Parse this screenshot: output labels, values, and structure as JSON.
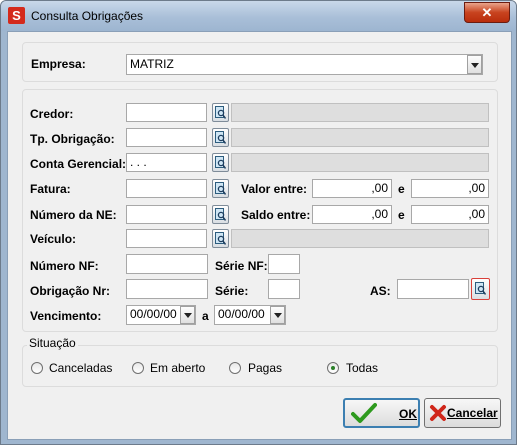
{
  "window": {
    "title": "Consulta Obrigações",
    "app_icon": "S",
    "close_glyph": "✕"
  },
  "empresa": {
    "label": "Empresa:",
    "value": "MATRIZ"
  },
  "filters": {
    "credor": {
      "label": "Credor:",
      "value": ""
    },
    "tp_obrigacao": {
      "label": "Tp. Obrigação:",
      "value": ""
    },
    "conta_gerencial": {
      "label": "Conta Gerencial:",
      "value": " .  .  . "
    },
    "fatura": {
      "label": "Fatura:",
      "value": ""
    },
    "numero_ne": {
      "label": "Número da NE:",
      "value": ""
    },
    "veiculo": {
      "label": "Veículo:",
      "value": ""
    },
    "valor_entre": {
      "label": "Valor entre:",
      "from": ",00",
      "sep": "e",
      "to": ",00"
    },
    "saldo_entre": {
      "label": "Saldo entre:",
      "from": ",00",
      "sep": "e",
      "to": ",00"
    },
    "numero_nf": {
      "label": "Número NF:",
      "value": ""
    },
    "serie_nf": {
      "label": "Série NF:",
      "value": ""
    },
    "obrigacao_nr": {
      "label": "Obrigação Nr:",
      "value": ""
    },
    "serie": {
      "label": "Série:",
      "value": ""
    },
    "as": {
      "label": "AS:",
      "value": ""
    },
    "vencimento": {
      "label": "Vencimento:",
      "from": "00/00/00",
      "sep": "a",
      "to": "00/00/00"
    }
  },
  "situacao": {
    "label": "Situação",
    "options": [
      "Canceladas",
      "Em aberto",
      "Pagas",
      "Todas"
    ],
    "selected": "Todas"
  },
  "buttons": {
    "ok": "OK",
    "cancelar": "Cancelar"
  },
  "colors": {
    "ok_check": "#2e9a1e",
    "cancel_x": "#d0261a",
    "as_lookup_border": "#d9403a"
  }
}
